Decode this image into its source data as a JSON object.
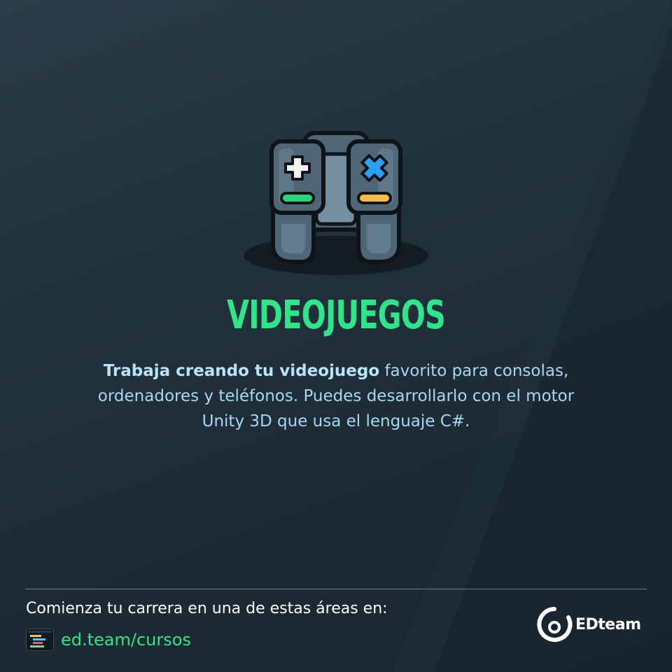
{
  "hero": {
    "title": "VIDEOJUEGOS",
    "description_bold": "Trabaja creando tu videojuego",
    "description_rest": " favorito para consolas, ordenadores y teléfonos. Puedes desarrollarlo con el motor Unity 3D que usa el lenguaje C#."
  },
  "footer": {
    "cta": "Comienza tu carrera en una de estas áreas en:",
    "link": "ed.team/cursos",
    "brand": "EDteam"
  },
  "icons": {
    "hero": "game-controller-icon",
    "link": "code-editor-icon",
    "brand": "edteam-logo"
  },
  "colors": {
    "accent": "#2ee589",
    "background": "#1c2a34",
    "description": "#a8d8f0",
    "controller_body": "#4f6677",
    "controller_shade": "#768fa0",
    "controller_outline": "#0f1418",
    "plus": "#f2f2f2",
    "cross": "#2b9ff0",
    "green_bar": "#2ed47b",
    "orange_bar": "#f6b94c"
  }
}
